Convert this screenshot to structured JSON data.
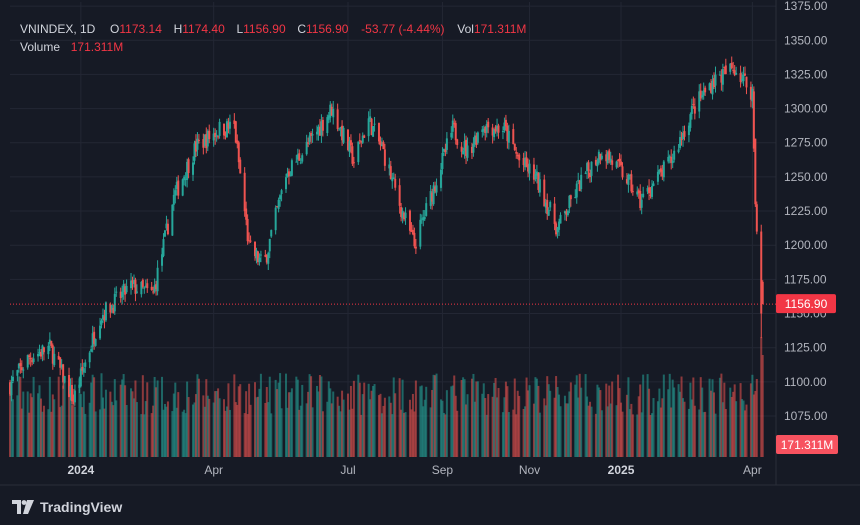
{
  "legend": {
    "symbol": "VNINDEX, 1D",
    "open_label": "O",
    "open": "1173.14",
    "high_label": "H",
    "high": "1174.40",
    "low_label": "L",
    "low": "1156.90",
    "close_label": "C",
    "close": "1156.90",
    "change": "-53.77 (-4.44%)",
    "vol_label": "Vol",
    "vol": "171.311M",
    "volume_label": "Volume",
    "volume": "171.311M"
  },
  "brand": {
    "name": "TradingView",
    "icon": "tradingview-logo-icon"
  },
  "colors": {
    "background": "#161a25",
    "up": "#26a69a",
    "down": "#ef5350",
    "grid": "#232734",
    "text": "#b2b5be"
  },
  "chart_data": {
    "type": "candlestick",
    "x_ticks": [
      {
        "label": "2024",
        "date": "2024-01-02"
      },
      {
        "label": "Apr",
        "date": "2024-04-01"
      },
      {
        "label": "Jul",
        "date": "2024-07-01"
      },
      {
        "label": "Sep",
        "date": "2024-09-03"
      },
      {
        "label": "Nov",
        "date": "2024-11-01"
      },
      {
        "label": "2025",
        "date": "2025-01-02"
      },
      {
        "label": "Apr",
        "date": "2025-04-01"
      }
    ],
    "y_ticks": [
      "1375.00",
      "1350.00",
      "1325.00",
      "1300.00",
      "1275.00",
      "1250.00",
      "1225.00",
      "1200.00",
      "1175.00",
      "1150.00",
      "1125.00",
      "1100.00",
      "1075.00"
    ],
    "ylim": [
      1045,
      1378
    ],
    "x_range": [
      "2023-11-15",
      "2025-04-17"
    ],
    "last_price": {
      "value": 1156.9,
      "label": "1156.90"
    },
    "last_volume_label": "171.311M",
    "price_waypoints": [
      [
        "2023-11-15",
        1098
      ],
      [
        "2023-11-28",
        1118
      ],
      [
        "2023-12-12",
        1125
      ],
      [
        "2023-12-28",
        1087
      ],
      [
        "2024-01-15",
        1148
      ],
      [
        "2024-02-05",
        1170
      ],
      [
        "2024-02-20",
        1164
      ],
      [
        "2024-03-05",
        1235
      ],
      [
        "2024-03-20",
        1272
      ],
      [
        "2024-04-05",
        1285
      ],
      [
        "2024-04-15",
        1287
      ],
      [
        "2024-04-25",
        1198
      ],
      [
        "2024-05-05",
        1185
      ],
      [
        "2024-05-20",
        1252
      ],
      [
        "2024-06-05",
        1275
      ],
      [
        "2024-06-20",
        1300
      ],
      [
        "2024-07-05",
        1262
      ],
      [
        "2024-07-15",
        1292
      ],
      [
        "2024-07-25",
        1268
      ],
      [
        "2024-08-05",
        1230
      ],
      [
        "2024-08-15",
        1200
      ],
      [
        "2024-08-25",
        1232
      ],
      [
        "2024-09-10",
        1285
      ],
      [
        "2024-09-20",
        1268
      ],
      [
        "2024-09-30",
        1288
      ],
      [
        "2024-10-15",
        1285
      ],
      [
        "2024-10-25",
        1262
      ],
      [
        "2024-11-05",
        1250
      ],
      [
        "2024-11-20",
        1212
      ],
      [
        "2024-12-05",
        1245
      ],
      [
        "2024-12-20",
        1270
      ],
      [
        "2025-01-05",
        1250
      ],
      [
        "2025-01-15",
        1232
      ],
      [
        "2025-02-05",
        1262
      ],
      [
        "2025-02-20",
        1300
      ],
      [
        "2025-03-05",
        1320
      ],
      [
        "2025-03-20",
        1330
      ],
      [
        "2025-04-01",
        1312
      ],
      [
        "2025-04-03",
        1230
      ],
      [
        "2025-04-04",
        1210
      ],
      [
        "2025-04-08",
        1157
      ]
    ],
    "final_candles": [
      {
        "date": "2025-04-03",
        "open": 1278,
        "high": 1278,
        "low": 1228,
        "close": 1230
      },
      {
        "date": "2025-04-04",
        "open": 1230,
        "high": 1232,
        "low": 1208,
        "close": 1210
      },
      {
        "date": "2025-04-07",
        "open": 1210,
        "high": 1215,
        "low": 1132,
        "close": 1150
      },
      {
        "date": "2025-04-08",
        "open": 1173.14,
        "high": 1174.4,
        "low": 1156.9,
        "close": 1156.9
      }
    ],
    "volume_scale_M": 171.311
  }
}
